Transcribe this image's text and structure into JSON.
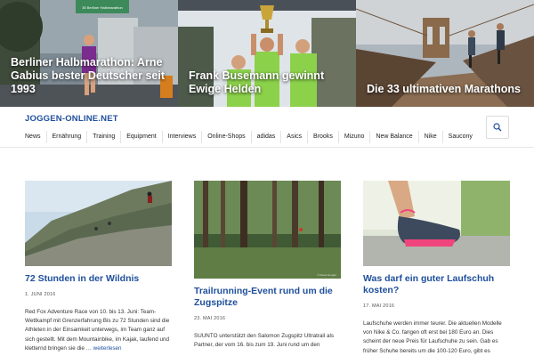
{
  "hero": [
    {
      "title": "Berliner Halbmarathon: Arne Gabius bester Deutscher seit 1993",
      "sign_text": "35 Berliner Halbmarathon"
    },
    {
      "title": "Frank Busemann gewinnt Ewige Helden"
    },
    {
      "title": "Die 33 ultimativen Marathons"
    }
  ],
  "header": {
    "site_title": "JOGGEN-ONLINE.NET",
    "nav": [
      "News",
      "Ernährung",
      "Training",
      "Equipment",
      "Interviews",
      "Online-Shops",
      "adidas",
      "Asics",
      "Brooks",
      "Mizuno",
      "New Balance",
      "Nike",
      "Saucony"
    ],
    "search_icon": "search-icon"
  },
  "posts": [
    {
      "title": "72 Stunden in der Wildnis",
      "date": "1. JUNI 2016",
      "excerpt": "Red Fox Adventure Race von 10. bis 13. Juni: Team-Wettkampf mit Grenzerfahrung Bis zu 72 Stunden sind die Athleten in der Einsamkeit unterwegs, im Team ganz auf sich gestellt. Mit dem Mountainbike, im Kajak, laufend und kletternd bringen sie die",
      "more": "… weiterlesen"
    },
    {
      "title": "Trailrunning-Event rund um die Zugspitze",
      "date": "23. MAI 2016",
      "excerpt": "SUUNTO unterstützt den Salomon Zugspitz Ultratrail als Partner, der vom 16. bis zum 19. Juni rund um den",
      "photo_credit": "© Klaus Fengler"
    },
    {
      "title": "Was darf ein guter Laufschuh kosten?",
      "date": "17. MAI 2016",
      "excerpt": "Laufschuhe werden immer teurer. Die aktuellen Modelle von Nike & Co. fangen oft erst bei 180 Euro an. Dies scheint der neue Preis für Laufschuhe zu sein. Gab es früher Schuhe bereits um die 100-120 Euro, gibt es"
    }
  ],
  "colors": {
    "link": "#1e4f9c",
    "text": "#2b2b2b",
    "border": "#e6e6e6"
  }
}
